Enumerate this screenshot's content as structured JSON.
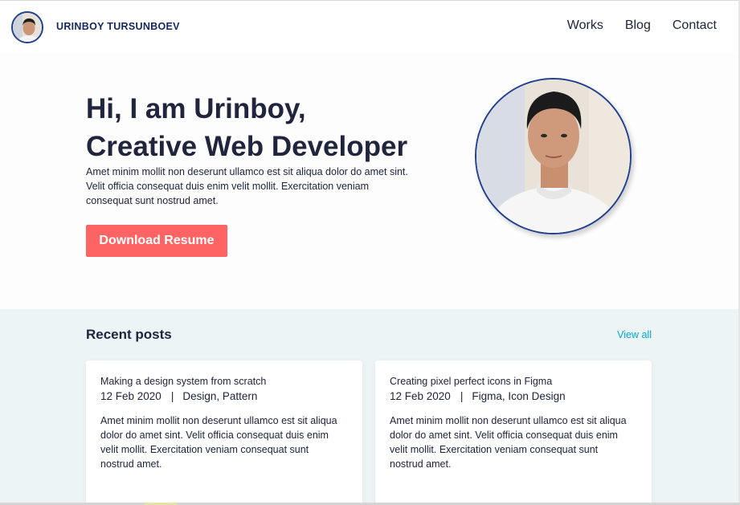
{
  "header": {
    "brand_name": "URINBOY TURSUNBOEV",
    "nav": [
      "Works",
      "Blog",
      "Contact"
    ]
  },
  "hero": {
    "title_line1": "Hi, I am Urinboy,",
    "title_line2": "Creative Web Developer",
    "description": "Amet minim mollit non deserunt ullamco est sit aliqua dolor do amet sint. Velit officia consequat duis enim velit mollit. Exercitation veniam consequat sunt nostrud amet.",
    "button_label": "Download Resume"
  },
  "posts": {
    "heading": "Recent posts",
    "view_all": "View all",
    "items": [
      {
        "title": "Making a design system from scratch",
        "date": "12 Feb 2020",
        "separator": "|",
        "tags": "Design, Pattern",
        "excerpt": "Amet minim mollit non deserunt ullamco est sit aliqua dolor do amet sint. Velit officia consequat duis enim velit mollit. Exercitation veniam consequat sunt nostrud amet."
      },
      {
        "title": "Creating pixel perfect icons in Figma",
        "date": "12 Feb 2020",
        "separator": "|",
        "tags": "Figma, Icon Design",
        "excerpt": "Amet minim mollit non deserunt ullamco est sit aliqua dolor do amet sint. Velit officia consequat duis enim velit mollit. Exercitation veniam consequat sunt nostrud amet."
      }
    ]
  },
  "colors": {
    "accent_button": "#ff6464",
    "link": "#00a8cc",
    "brand_text": "#152861",
    "avatar_ring": "#1f3f8f",
    "posts_background": "#edf4f6",
    "text": "#21243d"
  },
  "icons": {
    "brand_avatar": "profile-photo",
    "hero_photo": "profile-photo"
  }
}
